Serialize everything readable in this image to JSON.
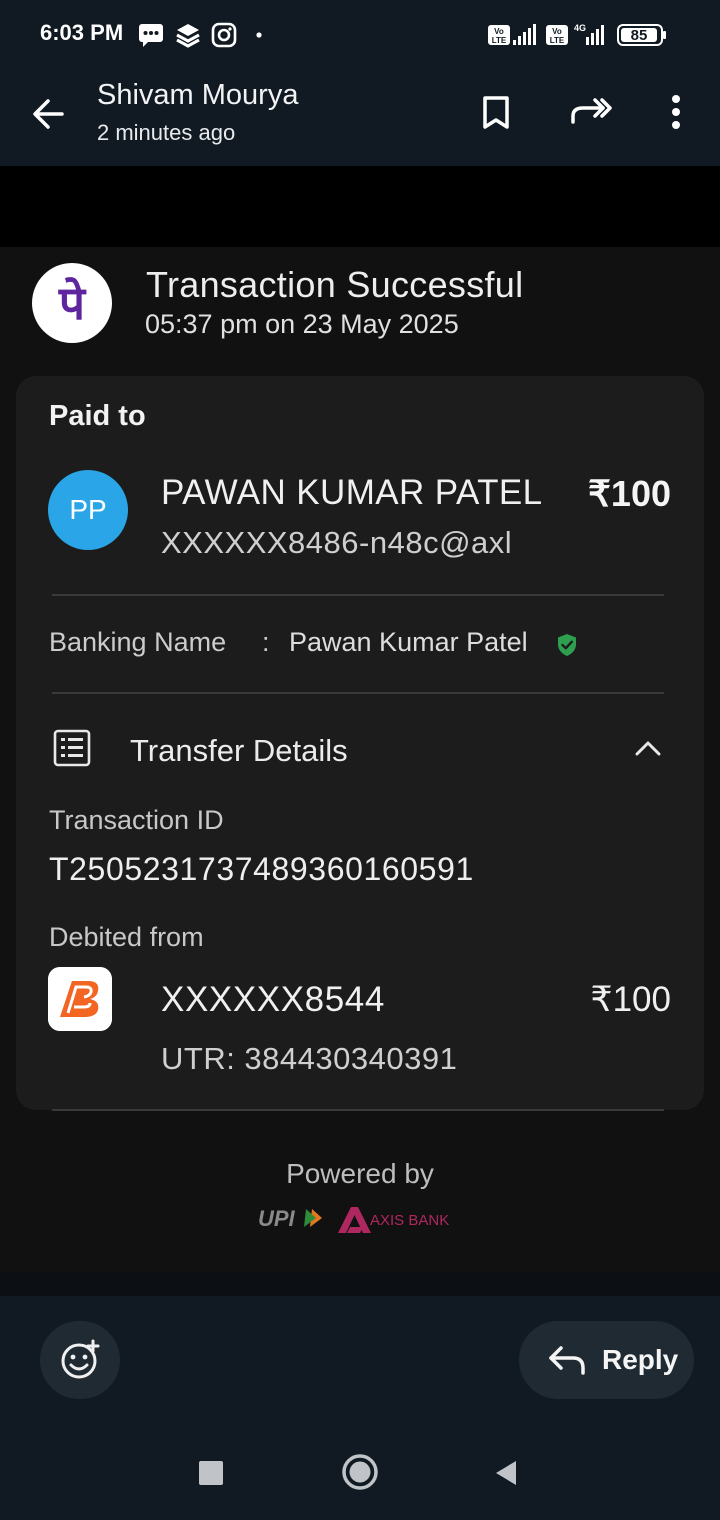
{
  "status_bar": {
    "time": "6:03 PM",
    "battery": "85",
    "network": "4G",
    "icons": [
      "message-icon",
      "layers-icon",
      "instagram-icon",
      "dot-icon",
      "volte-icon",
      "signal-icon",
      "volte-icon",
      "signal-4g-icon",
      "battery-icon"
    ]
  },
  "header": {
    "sender": "Shivam Mourya",
    "subtitle": "2 minutes ago",
    "actions": [
      "back-arrow-icon",
      "bookmark-icon",
      "forward-icon",
      "more-vertical-icon"
    ]
  },
  "transaction": {
    "title": "Transaction Successful",
    "datetime": "05:37 pm on 23 May 2025",
    "app_logo_glyph": "पे",
    "paid_to_label": "Paid to",
    "payee_initials": "PP",
    "payee_name": "PAWAN KUMAR PATEL",
    "payee_amount": "₹100",
    "payee_vpa": "XXXXXX8486-n48c@axl",
    "banking_name_label": "Banking Name",
    "banking_name_sep": ":",
    "banking_name": "Pawan Kumar Patel",
    "transfer_details_label": "Transfer Details",
    "transaction_id_label": "Transaction ID",
    "transaction_id": "T2505231737489360160591",
    "debited_from_label": "Debited from",
    "debit_account": "XXXXXX8544",
    "debit_amount": "₹100",
    "utr": "UTR: 384430340391",
    "powered_by": "Powered by",
    "upi_mark": "UPI",
    "bank_partner": "AXIS BANK"
  },
  "reply_bar": {
    "reply_label": "Reply"
  },
  "colors": {
    "phonepe_purple": "#5f259f",
    "avatar_blue": "#2aa6e8",
    "verified_green": "#2e9e4f",
    "axis_maroon": "#ae275f",
    "bob_orange": "#f26522"
  }
}
